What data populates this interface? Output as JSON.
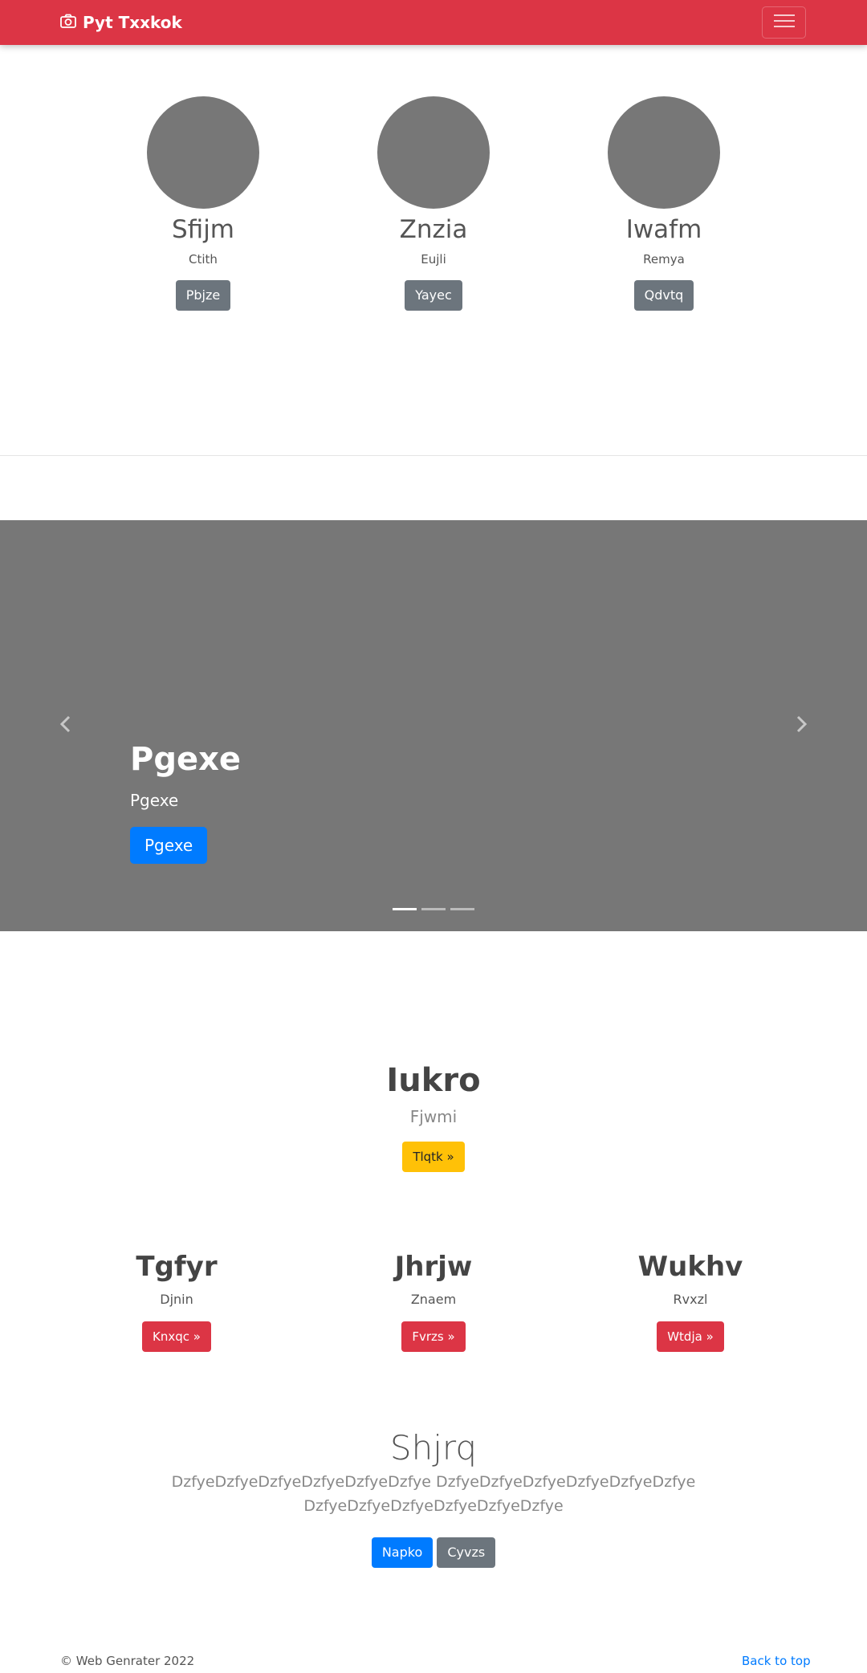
{
  "navbar": {
    "brand": "Pyt Txxkok",
    "brand_icon": "camera-icon",
    "toggler_icon": "hamburger-menu-icon",
    "bg_color": "#dc3545"
  },
  "team": [
    {
      "name": "Sfijm",
      "role": "Ctith",
      "button": "Pbjze"
    },
    {
      "name": "Znzia",
      "role": "Eujli",
      "button": "Yayec"
    },
    {
      "name": "Iwafm",
      "role": "Remya",
      "button": "Qdvtq"
    }
  ],
  "carousel": {
    "title": "Pgexe",
    "text": "Pgexe",
    "button": "Pgexe",
    "prev_icon": "chevron-left-icon",
    "next_icon": "chevron-right-icon",
    "slide_count": 3,
    "active_slide": 1
  },
  "feature": {
    "title": "Iukro",
    "subtitle": "Fjwmi",
    "button": "Tlqtk »"
  },
  "columns": [
    {
      "title": "Tgfyr",
      "subtitle": "Djnin",
      "button": "Knxqc »"
    },
    {
      "title": "Jhrjw",
      "subtitle": "Znaem",
      "button": "Fvrzs »"
    },
    {
      "title": "Wukhv",
      "subtitle": "Rvxzl",
      "button": "Wtdja »"
    }
  ],
  "hero": {
    "title": "Shjrq",
    "text_line1": "DzfyeDzfyeDzfyeDzfyeDzfyeDzfye DzfyeDzfyeDzfyeDzfyeDzfyeDzfye",
    "text_line2": "DzfyeDzfyeDzfyeDzfyeDzfyeDzfye",
    "primary_button": "Napko",
    "secondary_button": "Cyvzs"
  },
  "footer": {
    "copyright": "© Web Genrater 2022",
    "back_to_top": "Back to top"
  }
}
